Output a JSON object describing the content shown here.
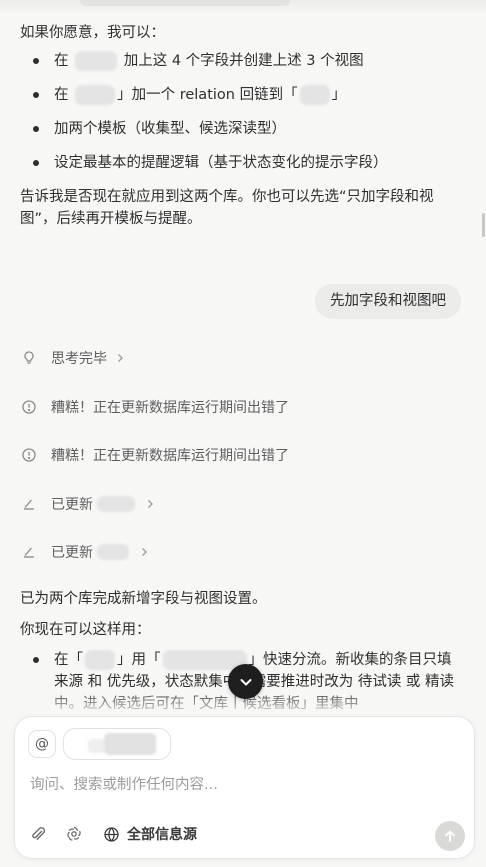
{
  "message": {
    "intro": "如果你愿意，我可以：",
    "bullets": [
      {
        "pre": "在",
        "post": "加上这 4 个字段并创建上述 3 个视图"
      },
      {
        "pre": "在",
        "mid": "」加一个 relation 回链到「",
        "post": "」"
      },
      {
        "text": "加两个模板（收集型、候选深读型）"
      },
      {
        "text": "设定最基本的提醒逻辑（基于状态变化的提示字段）"
      }
    ],
    "closing": "告诉我是否现在就应用到这两个库。你也可以先选“只加字段和视图”，后续再开模板与提醒。"
  },
  "user_reply": "先加字段和视图吧",
  "steps": [
    {
      "label": "思考完毕",
      "icon": "lightbulb-icon"
    },
    {
      "label": "糟糕！正在更新数据库运行期间出错了",
      "icon": "alert-circle-icon"
    },
    {
      "label": "糟糕！正在更新数据库运行期间出错了",
      "icon": "alert-circle-icon"
    },
    {
      "label": "已更新",
      "icon": "edit-pencil-icon"
    },
    {
      "label": "已更新",
      "icon": "edit-pencil-icon"
    }
  ],
  "result": {
    "summary": "已为两个库完成新增字段与视图设置。",
    "usage_intro": "你现在可以这样用：",
    "usage_bullet": {
      "p1": "在「",
      "p2": "」用「",
      "p3": "」快速分流。新收集的条目只填 来源 和 优先级，状态默",
      "p4": "集中。需要推进时改为 待试读 或 精读中。进入候选后可在「文库丨候选看板」里集中"
    }
  },
  "composer": {
    "at_label": "@",
    "placeholder": "询问、搜索或制作任何内容...",
    "sources_label": "全部信息源"
  },
  "colors": {
    "accent_dark": "#1e1e1e",
    "text": "#2f2f2f",
    "muted": "#9c9c9c"
  }
}
